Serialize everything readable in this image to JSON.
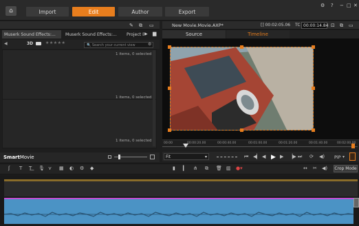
{
  "topbar": {
    "tabs": [
      {
        "label": "Import"
      },
      {
        "label": "Edit",
        "active": true
      },
      {
        "label": "Author"
      },
      {
        "label": "Export"
      }
    ]
  },
  "library": {
    "tabs": [
      "Muserk Sound Effects:...",
      "Muserk Sound Effects:...",
      "Project Bi"
    ],
    "mode_label": "3D",
    "search_placeholder": "Search your current view",
    "count_top": "1 items, 0 selected",
    "count_mid": "1 items, 0 selected",
    "count_bottom": "1 items, 0 selected",
    "smartmovie_label_a": "Smart",
    "smartmovie_label_b": "Movie"
  },
  "player": {
    "project_title": "New Movie.Movie.AXP*",
    "timecode_left": "[] 00:02:05.06",
    "timecode_right_prefix": "TC",
    "timecode_right": "00:00:14.84",
    "tab_source": "Source",
    "tab_timeline": "Timeline",
    "ruler_labels": [
      "00:00",
      "00:00:20.00",
      "00:00:40.00",
      "00:01:00.00",
      "00:01:20.00",
      "00:01:40.00",
      "00:02:00.00"
    ],
    "fit_label": "Fit",
    "pip_label": "PiP"
  },
  "timeline": {
    "crop_mode_label": "Crop Mode"
  },
  "colors": {
    "accent": "#e87e1e",
    "audio_clip": "#4b93c5",
    "audio_top": "#c24fd0",
    "title_track": "#8a6d2a"
  }
}
